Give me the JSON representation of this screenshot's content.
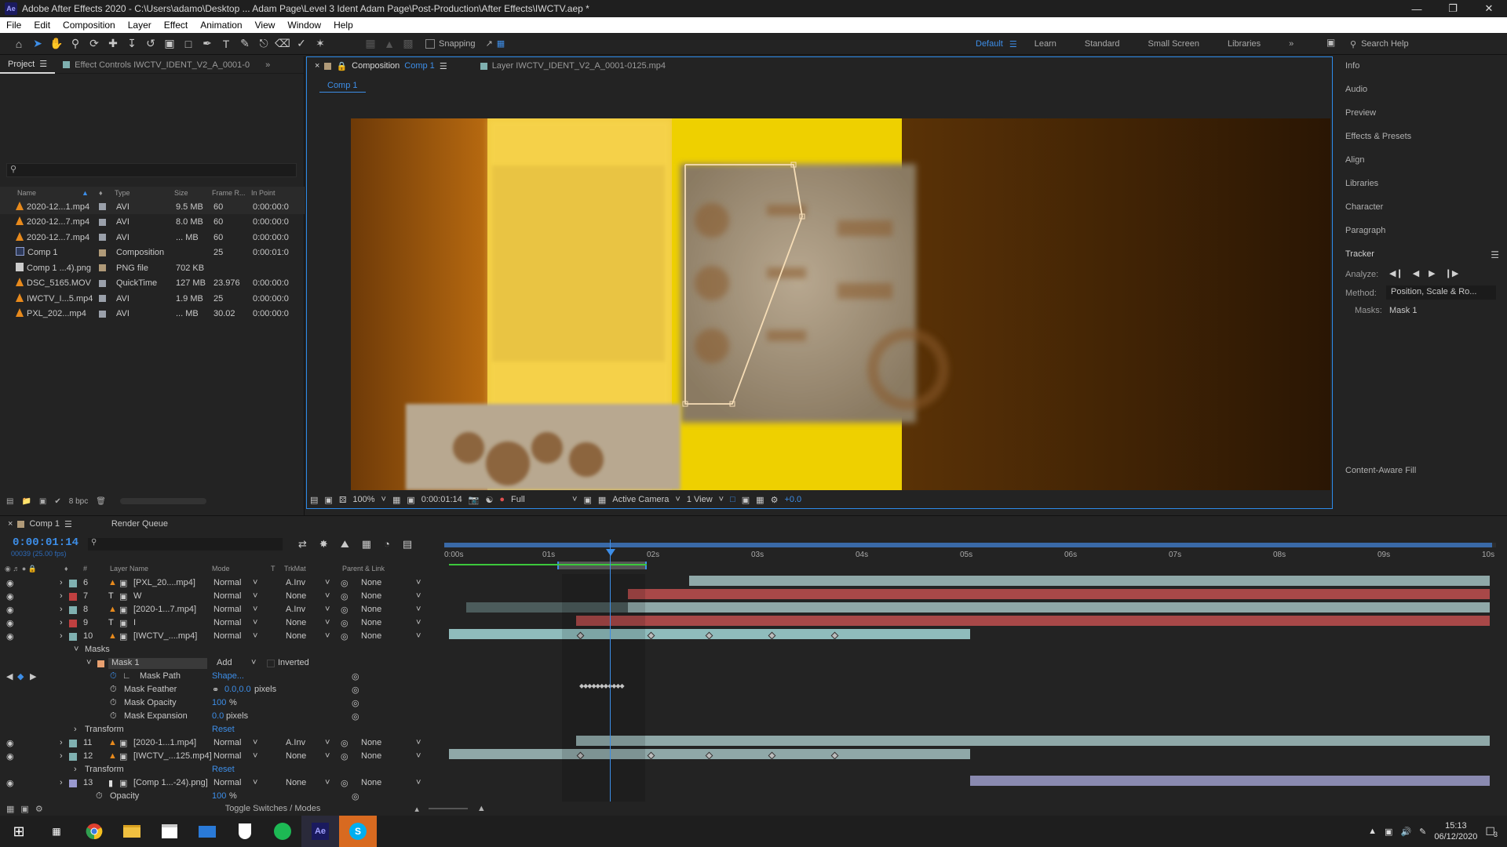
{
  "window": {
    "title": "Adobe After Effects 2020 - C:\\Users\\adamo\\Desktop ... Adam Page\\Level 3 Ident Adam Page\\Post-Production\\After Effects\\IWCTV.aep *",
    "logo": "Ae"
  },
  "menu": [
    "File",
    "Edit",
    "Composition",
    "Layer",
    "Effect",
    "Animation",
    "View",
    "Window",
    "Help"
  ],
  "toolbar": {
    "snapping_label": "Snapping",
    "workspaces": [
      "Default",
      "Learn",
      "Standard",
      "Small Screen",
      "Libraries"
    ],
    "active_workspace": "Default",
    "search_help_placeholder": "Search Help"
  },
  "project": {
    "tab_label": "Project",
    "effect_controls_tab": "Effect Controls IWCTV_IDENT_V2_A_0001-0",
    "search_placeholder": "",
    "columns": [
      "Name",
      "Type",
      "Size",
      "Frame R...",
      "In Point"
    ],
    "items": [
      {
        "name": "2020-12...1.mp4",
        "icon": "vlc-cone-icon",
        "label_color": "#9aa0aa",
        "type": "AVI",
        "size": "9.5 MB",
        "frame_rate": "60",
        "in_point": "0:00:00:0"
      },
      {
        "name": "2020-12...7.mp4",
        "icon": "vlc-cone-icon",
        "label_color": "#9aa0aa",
        "type": "AVI",
        "size": "8.0 MB",
        "frame_rate": "60",
        "in_point": "0:00:00:0"
      },
      {
        "name": "2020-12...7.mp4",
        "icon": "vlc-cone-icon",
        "label_color": "#9aa0aa",
        "type": "AVI",
        "size": "... MB",
        "frame_rate": "60",
        "in_point": "0:00:00:0"
      },
      {
        "name": "Comp 1",
        "icon": "composition-icon",
        "label_color": "#b09a78",
        "type": "Composition",
        "size": "",
        "frame_rate": "25",
        "in_point": "0:00:01:0"
      },
      {
        "name": "Comp 1 ...4).png",
        "icon": "png-file-icon",
        "label_color": "#b09a78",
        "type": "PNG file",
        "size": "702 KB",
        "frame_rate": "",
        "in_point": ""
      },
      {
        "name": "DSC_5165.MOV",
        "icon": "vlc-cone-icon",
        "label_color": "#9aa0aa",
        "type": "QuickTime",
        "size": "127 MB",
        "frame_rate": "23.976",
        "in_point": "0:00:00:0"
      },
      {
        "name": "IWCTV_I...5.mp4",
        "icon": "vlc-cone-icon",
        "label_color": "#9aa0aa",
        "type": "AVI",
        "size": "1.9 MB",
        "frame_rate": "25",
        "in_point": "0:00:00:0"
      },
      {
        "name": "PXL_202...mp4",
        "icon": "vlc-cone-icon",
        "label_color": "#9aa0aa",
        "type": "AVI",
        "size": "... MB",
        "frame_rate": "30.02",
        "in_point": "0:00:00:0"
      }
    ],
    "bpc": "8 bpc"
  },
  "composition": {
    "tab_prefix": "Composition",
    "tab_name": "Comp 1",
    "layer_tab": "Layer  IWCTV_IDENT_V2_A_0001-0125.mp4",
    "sub_tab": "Comp 1",
    "footer": {
      "zoom": "100%",
      "timecode": "0:00:01:14",
      "resolution": "Full",
      "camera": "Active Camera",
      "views": "1 View",
      "exposure": "+0.0"
    }
  },
  "right_panels": {
    "items": [
      "Info",
      "Audio",
      "Preview",
      "Effects & Presets",
      "Align",
      "Libraries",
      "Character",
      "Paragraph"
    ],
    "tracker": {
      "title": "Tracker",
      "analyze_label": "Analyze:",
      "method_label": "Method:",
      "method_value": "Position, Scale & Ro...",
      "masks_label": "Masks:",
      "masks_value": "Mask 1"
    },
    "content_aware_fill": "Content-Aware Fill"
  },
  "timeline": {
    "tab": "Comp 1",
    "render_queue": "Render Queue",
    "timecode": "0:00:01:14",
    "fps_info": "00039 (25.00 fps)",
    "columns": [
      "#",
      "Layer Name",
      "Mode",
      "T",
      "TrkMat",
      "Parent & Link"
    ],
    "ruler": [
      "0:00s",
      "01s",
      "02s",
      "03s",
      "04s",
      "05s",
      "06s",
      "07s",
      "08s",
      "09s",
      "10s"
    ],
    "layers": [
      {
        "num": "6",
        "name": "[PXL_20....mp4]",
        "icon": "vlc-cone-icon",
        "label": "#7fb0b0",
        "mode": "Normal",
        "trkmat": "A.Inv",
        "parent": "None"
      },
      {
        "num": "7",
        "name": "W",
        "icon": "text-layer-icon",
        "label": "#c04040",
        "mode": "Normal",
        "trkmat": "None",
        "parent": "None"
      },
      {
        "num": "8",
        "name": "[2020-1...7.mp4]",
        "icon": "vlc-cone-icon",
        "label": "#7fb0b0",
        "mode": "Normal",
        "trkmat": "A.Inv",
        "parent": "None"
      },
      {
        "num": "9",
        "name": "I",
        "icon": "text-layer-icon",
        "label": "#c04040",
        "mode": "Normal",
        "trkmat": "None",
        "parent": "None"
      },
      {
        "num": "10",
        "name": "[IWCTV_....mp4]",
        "icon": "vlc-cone-icon",
        "label": "#7fb0b0",
        "mode": "Normal",
        "trkmat": "None",
        "parent": "None"
      }
    ],
    "masks_group": "Masks",
    "mask": {
      "name": "Mask 1",
      "mode": "Add",
      "inverted": "Inverted",
      "path_label": "Mask Path",
      "path_value": "Shape...",
      "feather_label": "Mask Feather",
      "feather_value": "0.0,0.0",
      "feather_unit": "pixels",
      "opacity_label": "Mask Opacity",
      "opacity_value": "100",
      "opacity_unit": "%",
      "expansion_label": "Mask Expansion",
      "expansion_value": "0.0",
      "expansion_unit": "pixels"
    },
    "transform_label": "Transform",
    "reset_label": "Reset",
    "layers_bottom": [
      {
        "num": "11",
        "name": "[2020-1...1.mp4]",
        "icon": "vlc-cone-icon",
        "label": "#7fb0b0",
        "mode": "Normal",
        "trkmat": "A.Inv",
        "parent": "None"
      },
      {
        "num": "12",
        "name": "[IWCTV_...125.mp4]",
        "icon": "vlc-cone-icon",
        "label": "#7fb0b0",
        "mode": "Normal",
        "trkmat": "None",
        "parent": "None"
      },
      {
        "num": "13",
        "name": "[Comp 1...-24).png]",
        "icon": "png-file-icon",
        "label": "#9a9ad0",
        "mode": "Normal",
        "trkmat": "None",
        "parent": "None"
      }
    ],
    "opacity_label": "Opacity",
    "opacity_value": "100",
    "opacity_unit": "%",
    "toggle_label": "Toggle Switches / Modes"
  },
  "taskbar": {
    "time": "15:13",
    "date": "06/12/2020",
    "notifications": "3"
  }
}
